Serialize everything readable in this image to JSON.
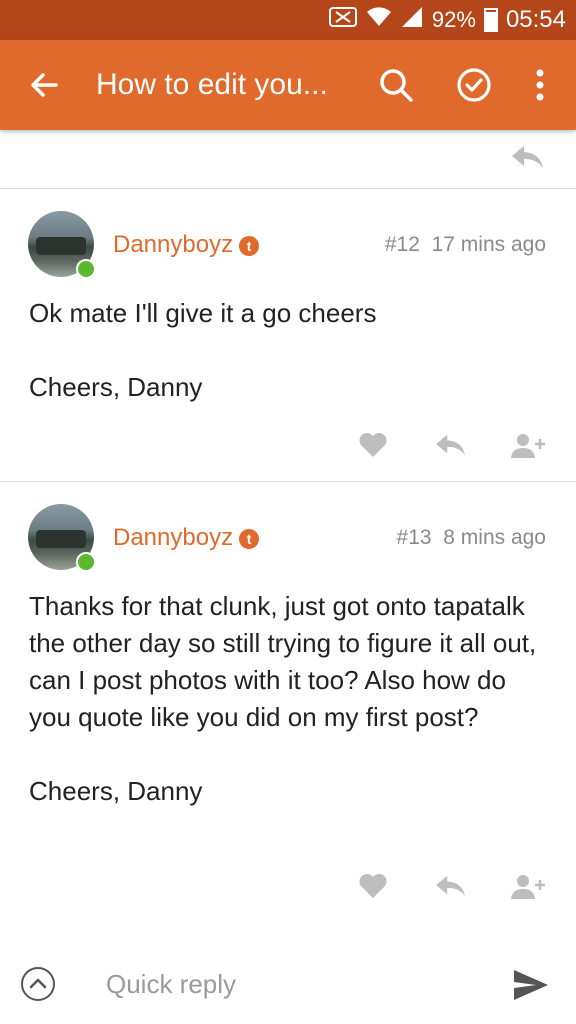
{
  "status": {
    "battery": "92%",
    "time": "05:54",
    "battery_level": 0.92
  },
  "appbar": {
    "title": "How to edit you..."
  },
  "posts": [
    {
      "author": "Dannyboyz",
      "badge": "t",
      "number": "#12",
      "time": "17 mins ago",
      "body": [
        "Ok mate I'll give it a go cheers",
        "Cheers, Danny"
      ]
    },
    {
      "author": "Dannyboyz",
      "badge": "t",
      "number": "#13",
      "time": "8 mins ago",
      "body": [
        "Thanks for that clunk, just got onto tapatalk the other day so still trying to figure it all out, can I post photos with it too? Also how do you quote like you did on my first post?",
        "Cheers, Danny"
      ]
    }
  ],
  "reply": {
    "placeholder": "Quick reply"
  },
  "colors": {
    "accent": "#e06a2c",
    "statusbar": "#b5461a",
    "online": "#5cb82e",
    "icon_gray": "#bdbdbd"
  }
}
